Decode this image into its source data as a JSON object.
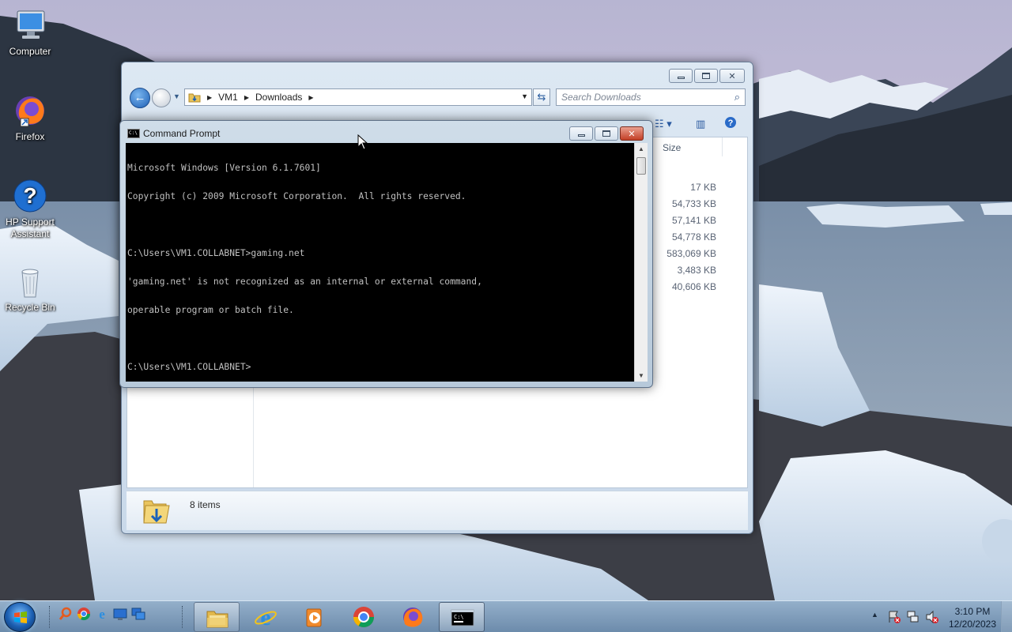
{
  "desktop": {
    "icons": [
      {
        "label": "Computer"
      },
      {
        "label": "Firefox"
      },
      {
        "label": "HP Support Assistant"
      },
      {
        "label": "Recycle Bin"
      }
    ]
  },
  "explorer": {
    "breadcrumb": [
      "VM1",
      "Downloads"
    ],
    "search_placeholder": "Search Downloads",
    "column_size_header": "Size",
    "sizes": [
      "17 KB",
      "54,733 KB",
      "57,141 KB",
      "54,778 KB",
      "583,069 KB",
      "3,483 KB",
      "40,606 KB"
    ],
    "status": "8 items"
  },
  "cmd": {
    "title": "Command Prompt",
    "lines": [
      "Microsoft Windows [Version 6.1.7601]",
      "Copyright (c) 2009 Microsoft Corporation.  All rights reserved.",
      "",
      "C:\\Users\\VM1.COLLABNET>gaming.net",
      "'gaming.net' is not recognized as an internal or external command,",
      "operable program or batch file.",
      "",
      "C:\\Users\\VM1.COLLABNET>"
    ]
  },
  "taskbar": {
    "clock_time": "3:10 PM",
    "clock_date": "12/20/2023",
    "pinned": [
      "Windows Explorer",
      "Internet Explorer",
      "Windows Media Player",
      "Google Chrome",
      "Firefox",
      "Command Prompt"
    ]
  },
  "colors": {
    "console_bg": "#000000",
    "console_fg": "#c0c0c0",
    "accent": "#1d5fb5"
  }
}
